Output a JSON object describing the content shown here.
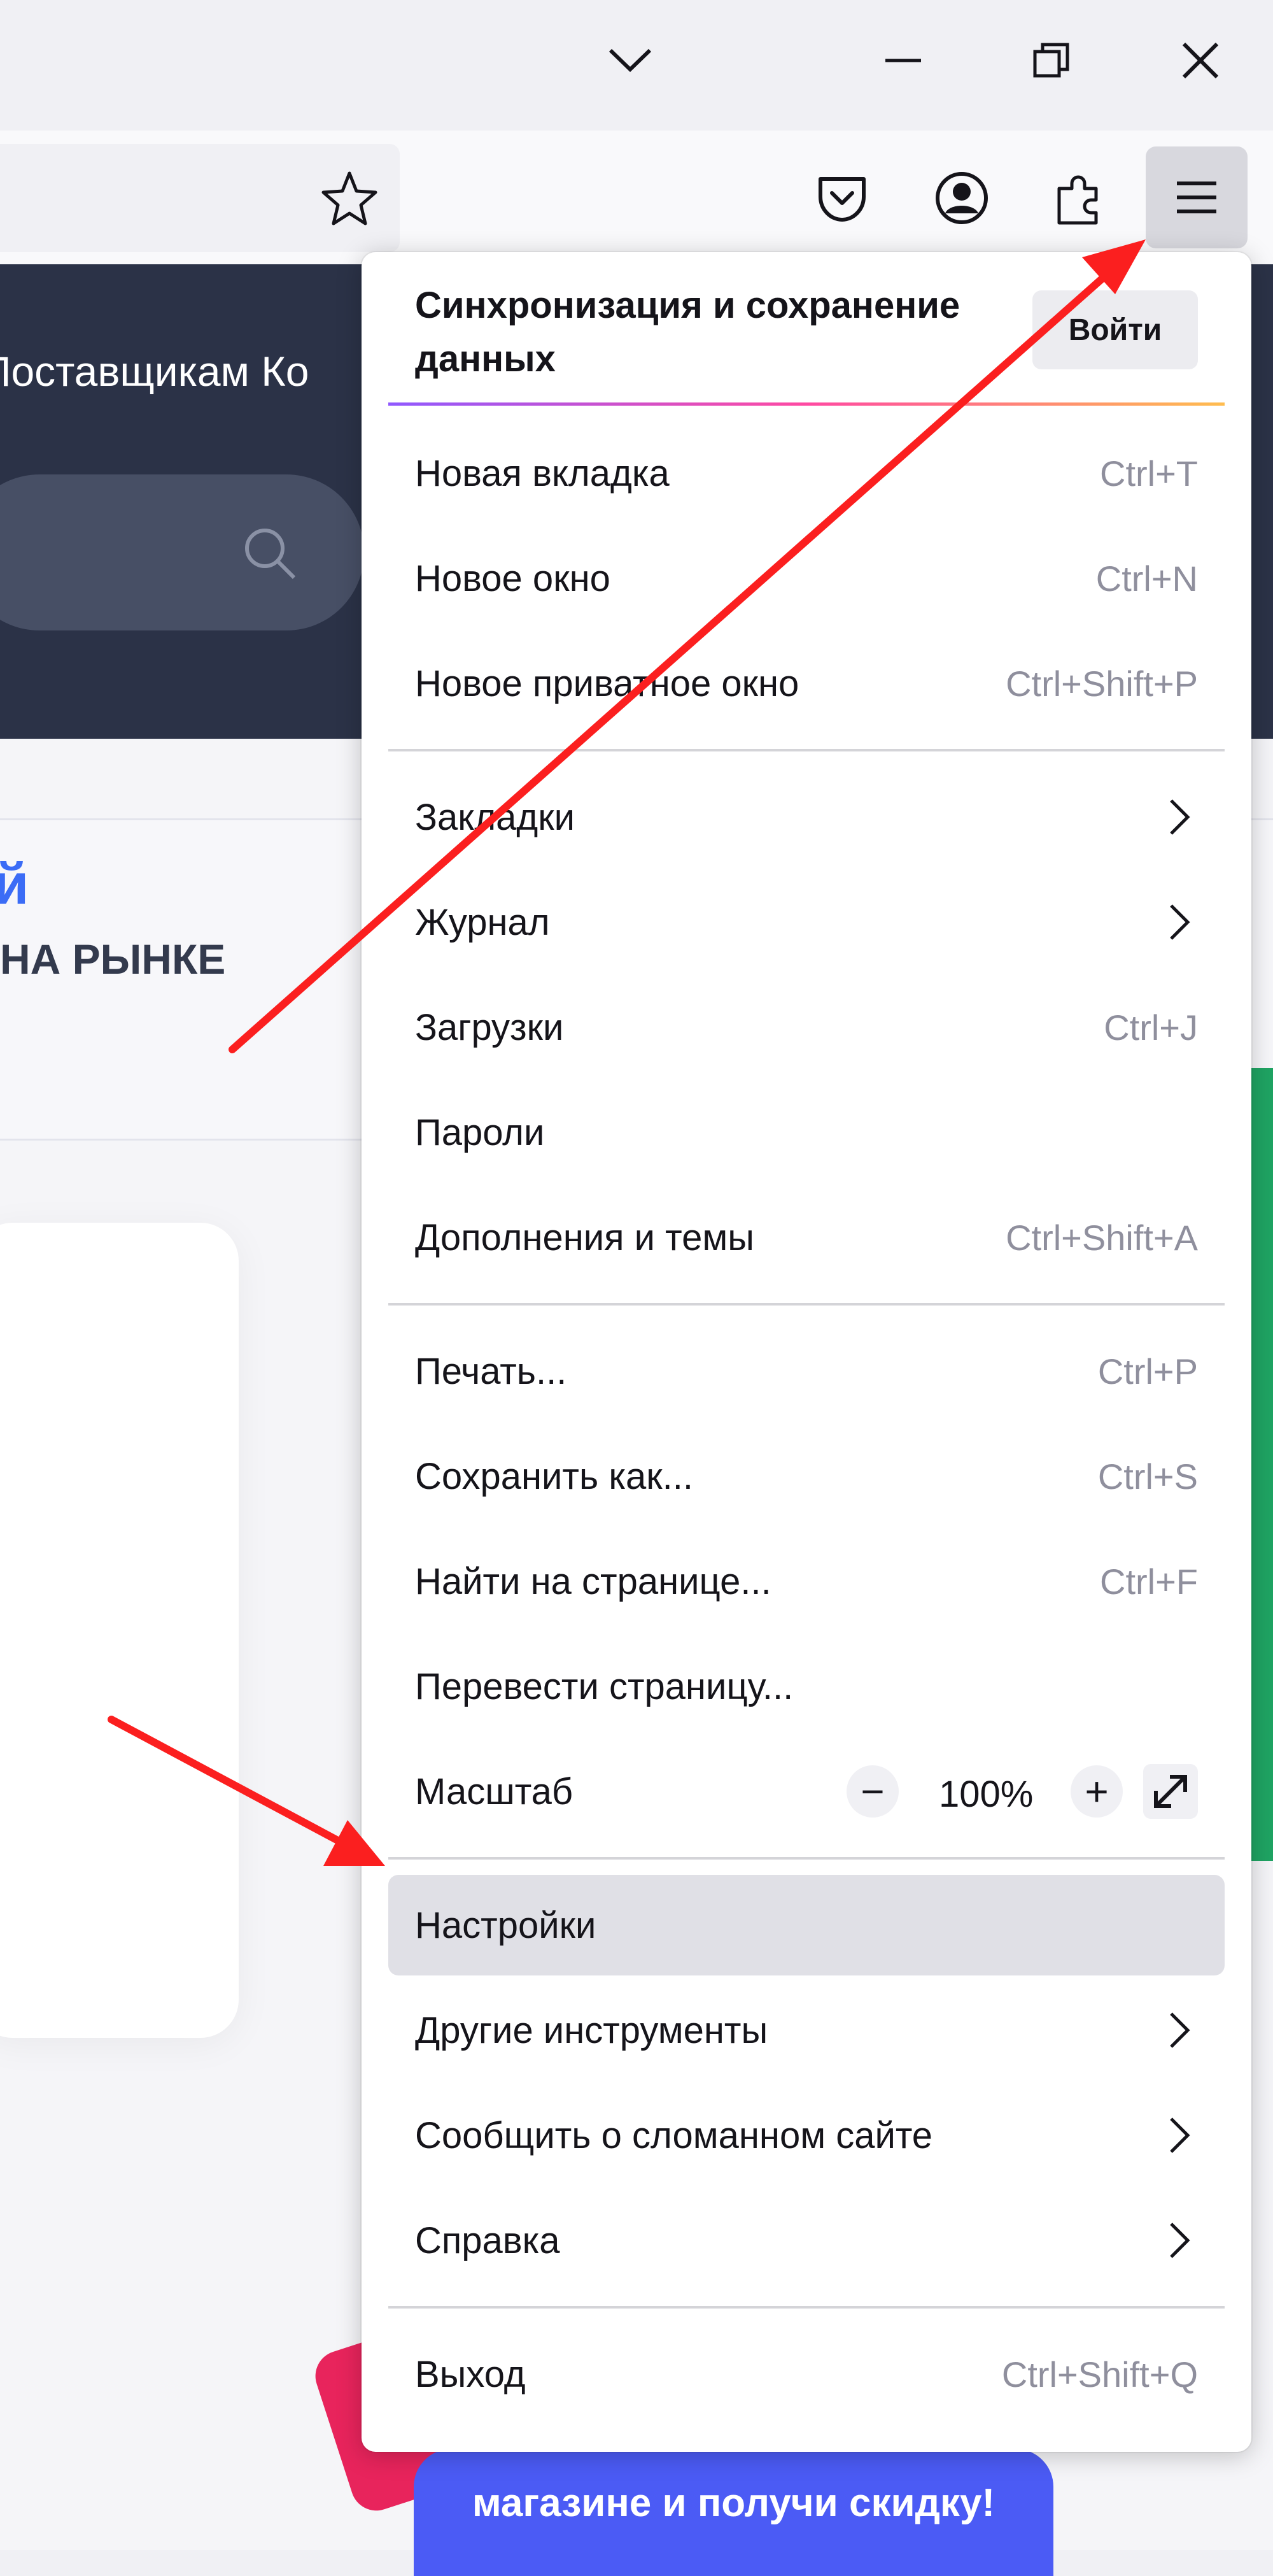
{
  "colors": {
    "arrow": "#fb1f1f",
    "site_header": "#2b3247",
    "accent": "#3b6cf6"
  },
  "window": {
    "controls": [
      {
        "name": "minimize",
        "icon": "minimize-icon"
      },
      {
        "name": "restore",
        "icon": "restore-icon"
      },
      {
        "name": "close",
        "icon": "close-icon"
      }
    ],
    "tab_list_icon": "chevron-down-icon"
  },
  "toolbar": {
    "icons": [
      "star-icon",
      "pocket-icon",
      "account-icon",
      "extensions-icon",
      "hamburger-menu-icon"
    ]
  },
  "site": {
    "nav_text": "Поставщикам   Ко",
    "hero_title": "й",
    "hero_subtitle": "НА РЫНКЕ",
    "promo_text": "магазине и получи скидку!"
  },
  "menu": {
    "sync_title": "Синхронизация и сохранение данных",
    "signin_label": "Войти",
    "items": [
      {
        "label": "Новая вкладка",
        "shortcut": "Ctrl+T"
      },
      {
        "label": "Новое окно",
        "shortcut": "Ctrl+N"
      },
      {
        "label": "Новое приватное окно",
        "shortcut": "Ctrl+Shift+P"
      },
      {
        "label": "Закладки",
        "shortcut": ""
      },
      {
        "label": "Журнал",
        "shortcut": ""
      },
      {
        "label": "Загрузки",
        "shortcut": "Ctrl+J"
      },
      {
        "label": "Пароли",
        "shortcut": ""
      },
      {
        "label": "Дополнения и темы",
        "shortcut": "Ctrl+Shift+A"
      },
      {
        "label": "Печать...",
        "shortcut": "Ctrl+P"
      },
      {
        "label": "Сохранить как...",
        "shortcut": "Ctrl+S"
      },
      {
        "label": "Найти на странице...",
        "shortcut": "Ctrl+F"
      },
      {
        "label": "Перевести страницу...",
        "shortcut": ""
      },
      {
        "label": "Масштаб",
        "shortcut": ""
      },
      {
        "label": "Настройки",
        "shortcut": ""
      },
      {
        "label": "Другие инструменты",
        "shortcut": ""
      },
      {
        "label": "Сообщить о сломанном сайте",
        "shortcut": ""
      },
      {
        "label": "Справка",
        "shortcut": ""
      },
      {
        "label": "Выход",
        "shortcut": "Ctrl+Shift+Q"
      }
    ],
    "zoom": {
      "minus": "−",
      "value": "100%",
      "plus": "+"
    }
  }
}
